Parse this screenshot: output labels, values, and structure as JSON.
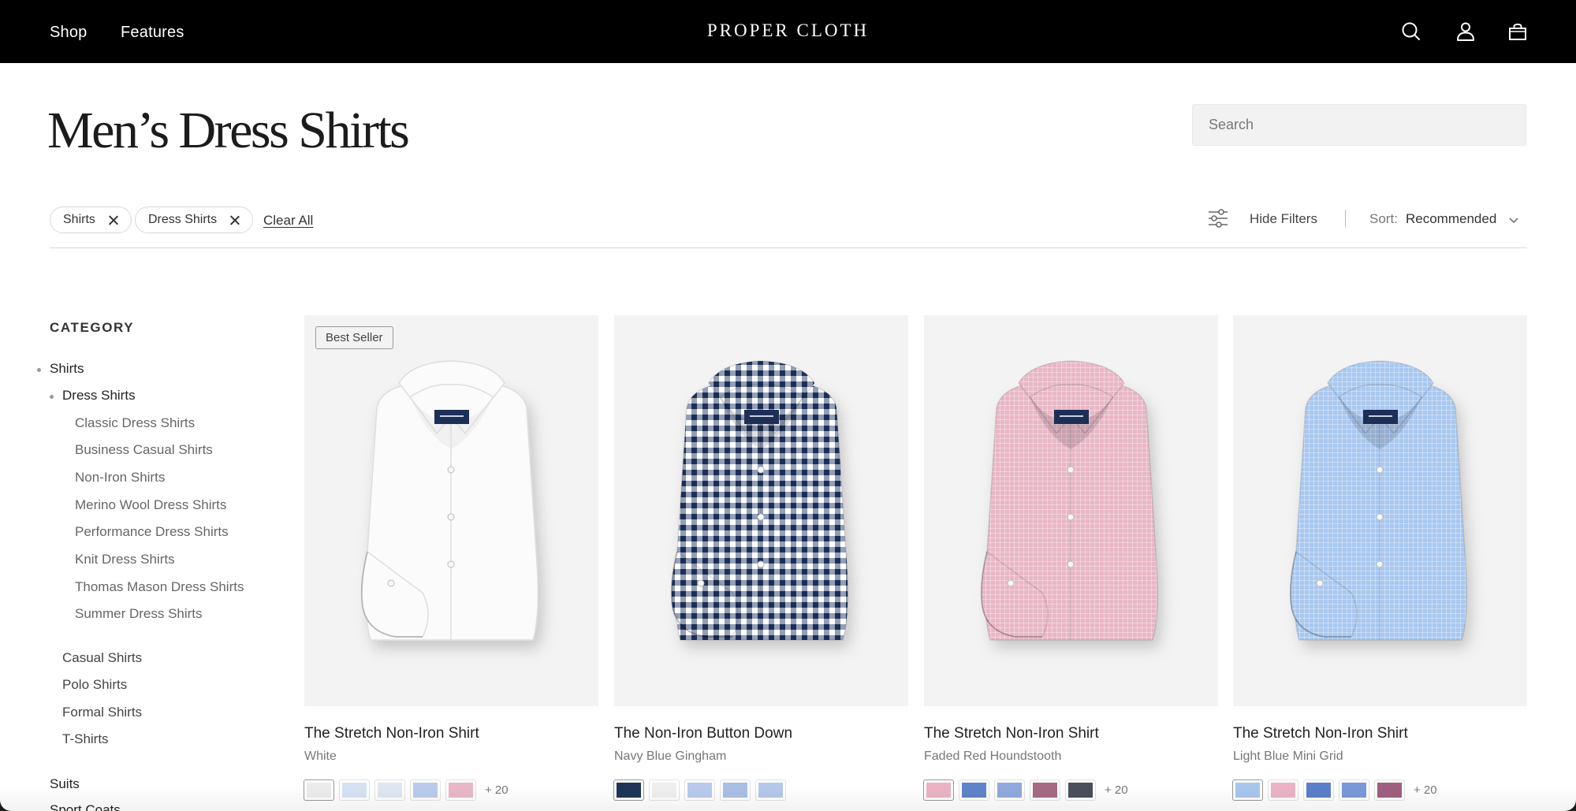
{
  "nav": {
    "links": [
      "Shop",
      "Features"
    ],
    "brand": "PROPER CLOTH",
    "icons": [
      "search-icon",
      "account-icon",
      "bag-icon"
    ]
  },
  "page": {
    "title": "Men’s Dress Shirts",
    "search_placeholder": "Search"
  },
  "filters": {
    "chips": [
      "Shirts",
      "Dress Shirts"
    ],
    "clear_all": "Clear All",
    "hide_filters": "Hide Filters",
    "sort_label": "Sort:",
    "sort_value": "Recommended"
  },
  "sidebar": {
    "heading": "CATEGORY",
    "items": [
      {
        "label": "Shirts",
        "level": 0,
        "active": true
      },
      {
        "label": "Dress Shirts",
        "level": 1,
        "active": true
      },
      {
        "label": "Classic Dress Shirts",
        "level": 2
      },
      {
        "label": "Business Casual Shirts",
        "level": 2
      },
      {
        "label": "Non-Iron Shirts",
        "level": 2
      },
      {
        "label": "Merino Wool Dress Shirts",
        "level": 2
      },
      {
        "label": "Performance Dress Shirts",
        "level": 2
      },
      {
        "label": "Knit Dress Shirts",
        "level": 2
      },
      {
        "label": "Thomas Mason Dress Shirts",
        "level": 2
      },
      {
        "label": "Summer Dress Shirts",
        "level": 2
      },
      {
        "label": "Casual Shirts",
        "level": 1
      },
      {
        "label": "Polo Shirts",
        "level": 1
      },
      {
        "label": "Formal Shirts",
        "level": 1
      },
      {
        "label": "T-Shirts",
        "level": 1
      },
      {
        "label": "Suits",
        "level": 0
      },
      {
        "label": "Sport Coats",
        "level": 0
      }
    ]
  },
  "products": [
    {
      "name": "The Stretch Non-Iron Shirt",
      "color": "White",
      "badge": "Best Seller",
      "shirt_color": "#fbfbfb",
      "pattern": "solid",
      "swatches": [
        "#ececec",
        "#d6e2f3",
        "#dfe7f2",
        "#b9ccec",
        "#e9b8c8"
      ],
      "more": "+ 20"
    },
    {
      "name": "The Non-Iron Button Down",
      "color": "Navy Blue Gingham",
      "badge": "",
      "shirt_color": "#ffffff",
      "pattern": "gingham",
      "swatches": [
        "#1e3558",
        "#efefef",
        "#b8cbed",
        "#aabfe6",
        "#b4c8ec"
      ],
      "more": ""
    },
    {
      "name": "The Stretch Non-Iron Shirt",
      "color": "Faded Red Houndstooth",
      "badge": "",
      "shirt_color": "#e8b7c6",
      "pattern": "fine",
      "swatches": [
        "#ebb3c4",
        "#5f84c9",
        "#90a9dd",
        "#a56a85",
        "#4a4f5c"
      ],
      "more": "+ 20"
    },
    {
      "name": "The Stretch Non-Iron Shirt",
      "color": "Light Blue Mini Grid",
      "badge": "",
      "shirt_color": "#a9c8f0",
      "pattern": "fine",
      "swatches": [
        "#a9c6ef",
        "#eab4c6",
        "#5b7fcb",
        "#7b99d8",
        "#9f5f80"
      ],
      "more": "+ 20"
    }
  ]
}
